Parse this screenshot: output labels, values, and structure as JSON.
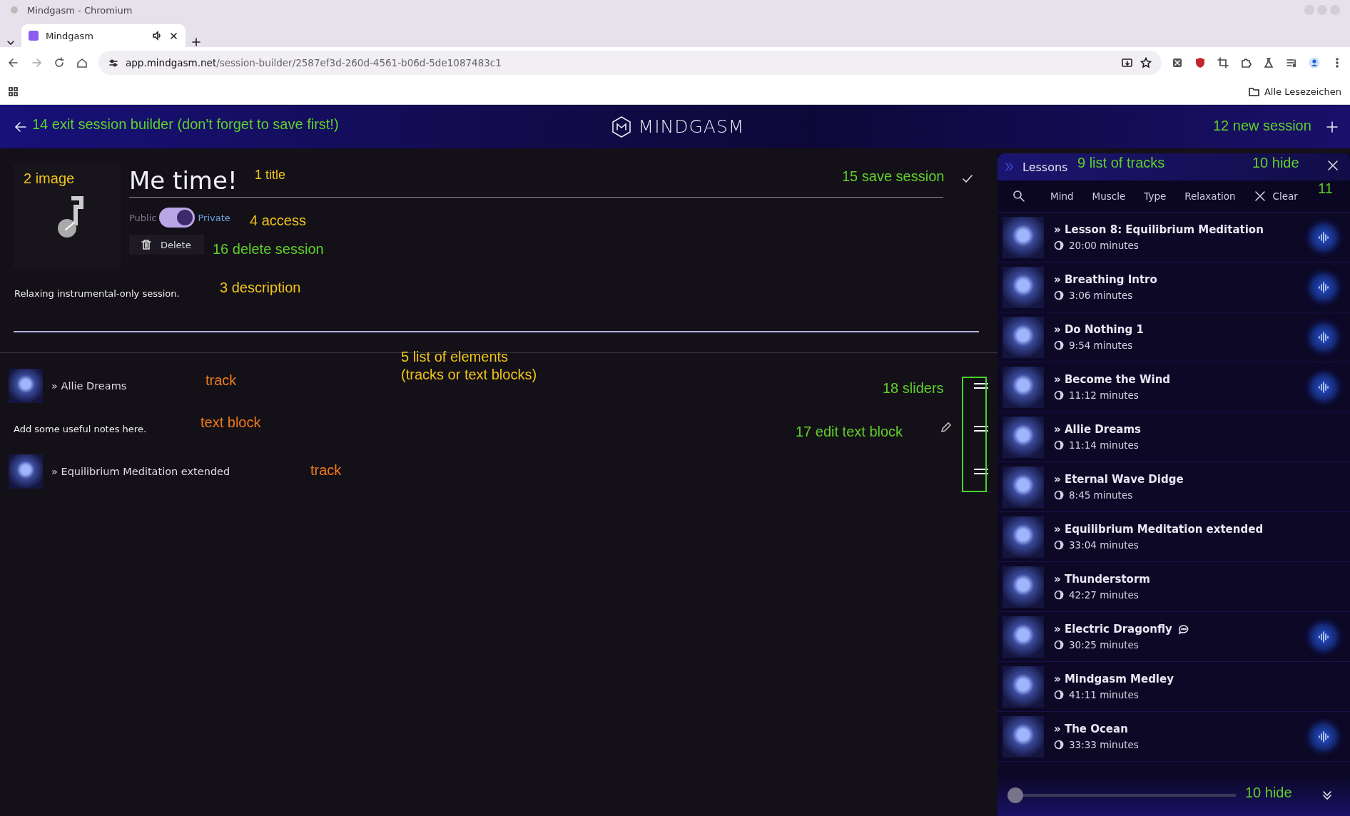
{
  "browser": {
    "window_title": "Mindgasm - Chromium",
    "tabs": [
      {
        "label": "Mindgasm",
        "selected": true
      }
    ],
    "url_host": "app.mindgasm.net",
    "url_path": "/session-builder/2587ef3d-260d-4561-b06d-5de1087483c1",
    "bookmarks_label": "Alle Lesezeichen"
  },
  "header": {
    "logo": "MINDGASM"
  },
  "session": {
    "title": "Me time!",
    "public_label": "Public",
    "private_label": "Private",
    "private": true,
    "delete_label": "Delete",
    "description": "Relaxing instrumental-only session."
  },
  "elements": [
    {
      "kind": "track",
      "title": "» Allie Dreams"
    },
    {
      "kind": "text",
      "title": "Add some useful notes here."
    },
    {
      "kind": "track",
      "title": "» Equilibrium Meditation extended"
    }
  ],
  "panel": {
    "title": "Lessons",
    "filters": [
      "Mind",
      "Muscle",
      "Type",
      "Relaxation"
    ],
    "clear_label": "Clear",
    "tracks": [
      {
        "title": "» Lesson 8: Equilibrium Meditation",
        "duration": "20:00 minutes",
        "playable": true,
        "comments": false
      },
      {
        "title": "» Breathing Intro",
        "duration": "3:06 minutes",
        "playable": true,
        "comments": false
      },
      {
        "title": "» Do Nothing 1",
        "duration": "9:54 minutes",
        "playable": true,
        "comments": false
      },
      {
        "title": "» Become the Wind",
        "duration": "11:12 minutes",
        "playable": true,
        "comments": false
      },
      {
        "title": "» Allie Dreams",
        "duration": "11:14 minutes",
        "playable": false,
        "comments": false
      },
      {
        "title": "» Eternal Wave Didge",
        "duration": "8:45 minutes",
        "playable": false,
        "comments": false
      },
      {
        "title": "» Equilibrium Meditation extended",
        "duration": "33:04 minutes",
        "playable": false,
        "comments": false
      },
      {
        "title": "» Thunderstorm",
        "duration": "42:27 minutes",
        "playable": false,
        "comments": false
      },
      {
        "title": "» Electric Dragonfly",
        "duration": "30:25 minutes",
        "playable": true,
        "comments": true
      },
      {
        "title": "» Mindgasm Medley",
        "duration": "41:11 minutes",
        "playable": false,
        "comments": false
      },
      {
        "title": "» The Ocean",
        "duration": "33:33 minutes",
        "playable": true,
        "comments": false
      }
    ],
    "player": {
      "level": 0
    }
  },
  "annotations": [
    {
      "text": "14 exit session builder (don't forget to save first!)",
      "color": "#5fd12a"
    },
    {
      "text": "12 new session",
      "color": "#5fd12a"
    },
    {
      "text": "2 image",
      "color": "#f0c419"
    },
    {
      "text": "1 title",
      "color": "#f0c419"
    },
    {
      "text": "15 save session",
      "color": "#5fd12a"
    },
    {
      "text": "4 access",
      "color": "#f0c419"
    },
    {
      "text": "16 delete session",
      "color": "#5fd12a"
    },
    {
      "text": "3 description",
      "color": "#f0c419"
    },
    {
      "text": "5 list of elements",
      "color": "#f0c419"
    },
    {
      "text": "track",
      "color": "#f07a1a"
    },
    {
      "text": "(tracks or text blocks)",
      "color": "#f0c419"
    },
    {
      "text": "text block",
      "color": "#f07a1a"
    },
    {
      "text": "track",
      "color": "#f07a1a"
    },
    {
      "text": "18 sliders",
      "color": "#5fd12a"
    },
    {
      "text": "17 edit text block",
      "color": "#5fd12a"
    },
    {
      "text": "9 list of tracks",
      "color": "#5fd12a"
    },
    {
      "text": "10 hide",
      "color": "#5fd12a"
    },
    {
      "text": "11",
      "color": "#5fd12a"
    },
    {
      "text": "10 hide",
      "color": "#5fd12a"
    }
  ]
}
